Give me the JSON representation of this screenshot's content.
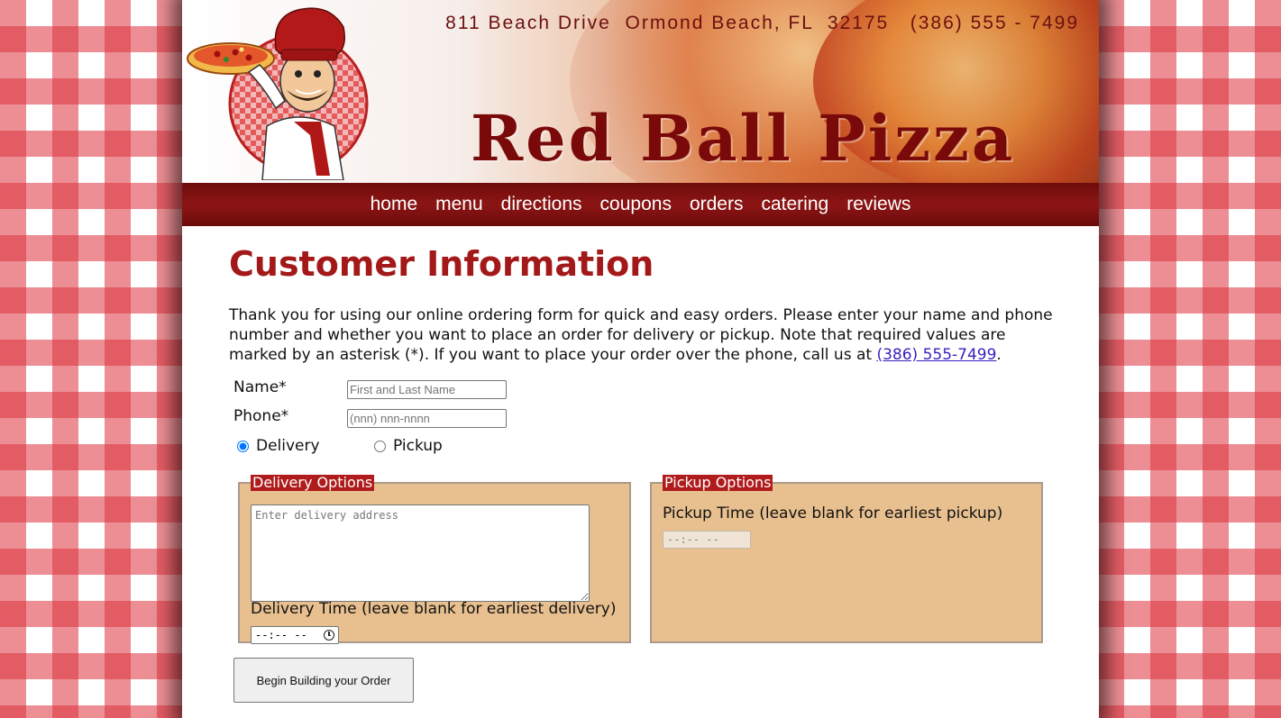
{
  "header": {
    "address": "811 Beach Drive  Ormond Beach, FL  32175   (386) 555 - 7499",
    "brand": "Red Ball Pizza"
  },
  "nav": {
    "items": [
      "home",
      "menu",
      "directions",
      "coupons",
      "orders",
      "catering",
      "reviews"
    ]
  },
  "main": {
    "title": "Customer Information",
    "intro_text": "Thank you for using our online ordering form for quick and easy orders. Please enter your name and phone number and whether you want to place an order for delivery or pickup. Note that required values are marked by an asterisk (*). If you want to place your order over the phone, call us at ",
    "intro_phone_link": "(386) 555-7499",
    "intro_end": "."
  },
  "form": {
    "name_label": "Name*",
    "name_placeholder": "First and Last Name",
    "phone_label": "Phone*",
    "phone_placeholder": "(nnn) nnn-nnnn",
    "delivery_label": "Delivery",
    "pickup_label": "Pickup",
    "selected_option": "Delivery",
    "delivery": {
      "legend": "Delivery Options",
      "address_placeholder": "Enter delivery address",
      "time_label": "Delivery Time (leave blank for earliest delivery)",
      "time_value": "--:-- --"
    },
    "pickup": {
      "legend": "Pickup Options",
      "time_label": "Pickup Time (leave blank for earliest pickup)",
      "time_value": "--:-- --"
    },
    "submit_label": "Begin Building your Order"
  },
  "colors": {
    "accent": "#a31818",
    "nav_bg": "#8d1515",
    "fieldset_bg": "#e8c08f",
    "legend_bg": "#b01c1c",
    "link": "#3a1fbf"
  },
  "icons": [
    "chef-logo-icon",
    "clock-icon"
  ]
}
